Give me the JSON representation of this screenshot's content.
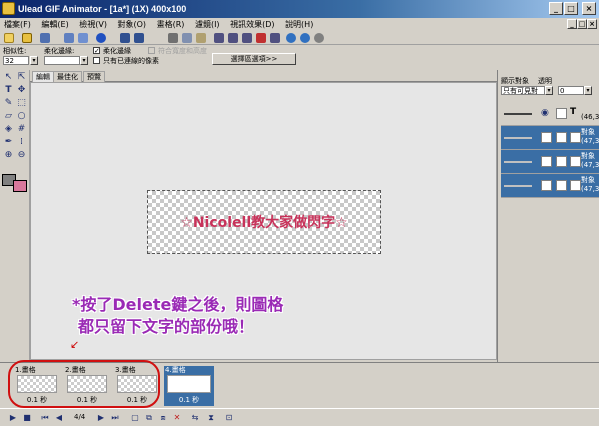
{
  "window": {
    "title": "Ulead GIF Animator - [1a*] (1X) 400x100"
  },
  "menu": [
    "檔案(F)",
    "編輯(E)",
    "檢視(V)",
    "對象(O)",
    "畫格(R)",
    "濾鏡(I)",
    "視訊效果(D)",
    "說明(H)"
  ],
  "options": {
    "similarity_label": "相似性:",
    "similarity_value": "32",
    "feather_label": "柔化邊緣:",
    "feather_value": "",
    "antialias_label": "柔化邊緣",
    "antialias_checked": true,
    "fit_label": "符合寬度和高度",
    "only_edge_label": "只有已連線的像素",
    "select_options_button": "選擇區選項>>"
  },
  "tabs": [
    "編輯",
    "最佳化",
    "預覽"
  ],
  "canvas": {
    "text": "☆Nicolell教大家做閃字☆"
  },
  "annotation": {
    "line1": "*按了Delete鍵之後，則圖格",
    "line2": "都只留下文字的部份哦！",
    "arrow": "↙"
  },
  "objects_panel": {
    "display_label": "顯示對象",
    "transparent_label": "透明",
    "display_value": "只有可見對",
    "transparent_value": "0",
    "rows": [
      {
        "name": "",
        "coords": "(46,3"
      },
      {
        "name": "對象",
        "coords": "(47,3"
      },
      {
        "name": "對象",
        "coords": "(47,3"
      },
      {
        "name": "對象",
        "coords": "(47,3"
      }
    ]
  },
  "frames": [
    {
      "label": "1.畫格",
      "delay": "0.1 秒"
    },
    {
      "label": "2.畫格",
      "delay": "0.1 秒"
    },
    {
      "label": "3.畫格",
      "delay": "0.1 秒"
    },
    {
      "label": "4.畫格",
      "delay": "0.1 秒"
    }
  ],
  "playback": {
    "counter": "4/4"
  },
  "colors": {
    "foreground": "#808080",
    "background": "#d9789c",
    "selection": "#3a6ea5"
  }
}
